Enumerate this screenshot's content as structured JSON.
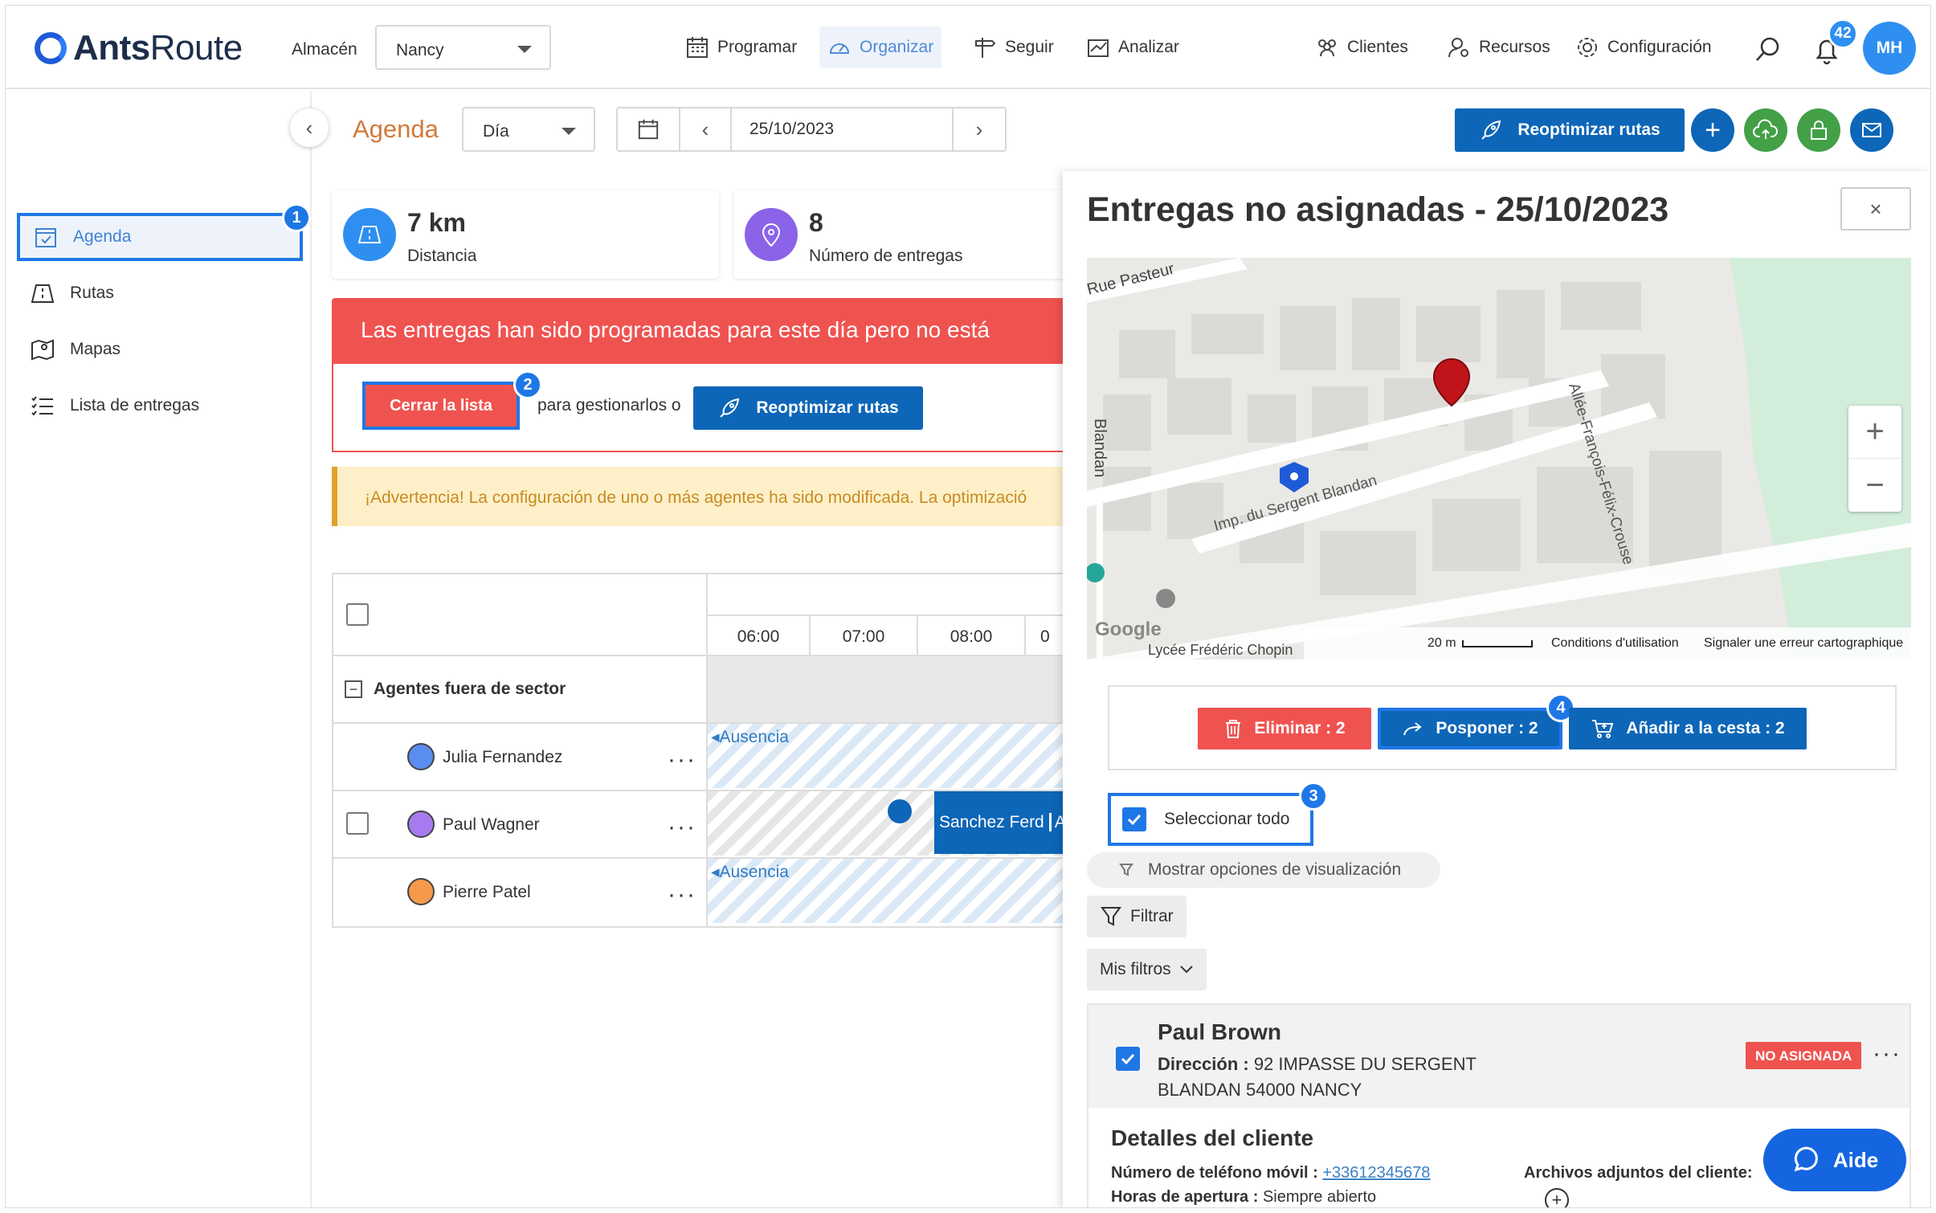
{
  "header": {
    "logo_brand": "Ants",
    "logo_suffix": "Route",
    "warehouse_label": "Almacén",
    "warehouse_value": "Nancy",
    "nav": [
      {
        "label": "Programar",
        "icon": "calendar-icon"
      },
      {
        "label": "Organizar",
        "icon": "dashboard-icon",
        "active": true
      },
      {
        "label": "Seguir",
        "icon": "signpost-icon"
      },
      {
        "label": "Analizar",
        "icon": "chart-icon"
      }
    ],
    "right_nav": [
      {
        "label": "Clientes",
        "icon": "users-icon"
      },
      {
        "label": "Recursos",
        "icon": "resources-icon"
      },
      {
        "label": "Configuración",
        "icon": "gear-icon"
      }
    ],
    "notifications_count": "42",
    "user_initials": "MH"
  },
  "sidebar": {
    "items": [
      {
        "label": "Agenda",
        "icon": "agenda-icon",
        "active": true,
        "step": "1"
      },
      {
        "label": "Rutas",
        "icon": "routes-icon"
      },
      {
        "label": "Mapas",
        "icon": "map-icon"
      },
      {
        "label": "Lista de entregas",
        "icon": "list-icon"
      }
    ]
  },
  "subheader": {
    "title": "Agenda",
    "view_select": "Día",
    "date": "25/10/2023",
    "reoptimize_label": "Reoptimizar rutas"
  },
  "stats": [
    {
      "value": "7 km",
      "label": "Distancia"
    },
    {
      "value": "8",
      "label": "Número de entregas"
    }
  ],
  "alert": {
    "message": "Las entregas han sido programadas para este día pero no está",
    "close_list_label": "Cerrar la lista",
    "close_step": "2",
    "middle_text": "para gestionarlos o",
    "reoptimize_label": "Reoptimizar rutas"
  },
  "warning": {
    "strong": "¡Advertencia!",
    "text": " La configuración de uno o más agentes ha sido modificada. La optimizació"
  },
  "schedule": {
    "hours": [
      "06:00",
      "07:00",
      "08:00",
      "0"
    ],
    "group_label": "Agentes fuera de sector",
    "agents": [
      {
        "name": "Julia Fernandez",
        "color": "#5b8def",
        "event": "Ausencia"
      },
      {
        "name": "Paul Wagner",
        "color": "#a77bef",
        "event": "Sanchez Ferd",
        "event2": "Ad"
      },
      {
        "name": "Pierre Patel",
        "color": "#f59a4a",
        "event": "Ausencia"
      }
    ]
  },
  "panel": {
    "title": "Entregas no asignadas - 25/10/2023",
    "close_label": "×",
    "map": {
      "street1": "Rue Pasteur",
      "street2": "Imp. du Sergent Blandan",
      "street3": "Allée-François-Félix-Crouse",
      "street4": "Blandan",
      "attribution": "Google",
      "scale": "20 m",
      "terms": "Conditions d'utilisation",
      "report": "Signaler une erreur cartographique",
      "bottom_text": "Lycée Frédéric Chopin"
    },
    "actions": {
      "delete_label": "Eliminar : 2",
      "postpone_label": "Posponer : 2",
      "postpone_step": "4",
      "basket_label": "Añadir a la cesta : 2"
    },
    "select_all_label": "Seleccionar todo",
    "select_all_step": "3",
    "display_options_label": "Mostrar opciones de visualización",
    "filter_label": "Filtrar",
    "my_filters_label": "Mis filtros",
    "delivery": {
      "name": "Paul Brown",
      "address_label": "Dirección :",
      "address": " 92 IMPASSE DU SERGENT",
      "address2": "BLANDAN 54000 NANCY",
      "status": "NO ASIGNADA",
      "details_title": "Detalles del cliente",
      "phone_label": "Número de teléfono móvil :",
      "phone": "+33612345678",
      "hours_label": "Horas de apertura :",
      "hours": " Siempre abierto",
      "attachments_label": "Archivos adjuntos del cliente:"
    }
  },
  "help_button": "Aide"
}
